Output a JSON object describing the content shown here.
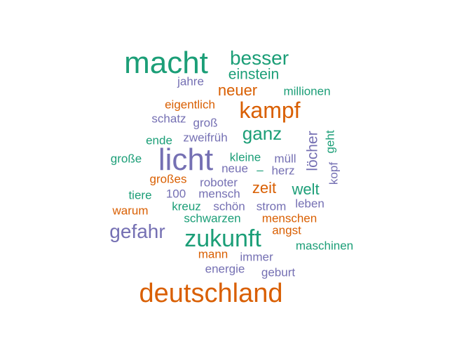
{
  "palette": {
    "green": "#1b9e77",
    "orange": "#d95f02",
    "purple": "#7570b3"
  },
  "words": [
    {
      "text": "deutschland",
      "weight": 10,
      "color": "orange"
    },
    {
      "text": "macht",
      "weight": 9,
      "color": "green"
    },
    {
      "text": "licht",
      "weight": 9,
      "color": "purple"
    },
    {
      "text": "zukunft",
      "weight": 8,
      "color": "green"
    },
    {
      "text": "kampf",
      "weight": 7,
      "color": "orange"
    },
    {
      "text": "gefahr",
      "weight": 6,
      "color": "purple"
    },
    {
      "text": "besser",
      "weight": 6,
      "color": "green"
    },
    {
      "text": "ganz",
      "weight": 6,
      "color": "green"
    },
    {
      "text": "löcher",
      "weight": 5,
      "color": "purple",
      "vertical": true
    },
    {
      "text": "einstein",
      "weight": 5,
      "color": "green"
    },
    {
      "text": "neuer",
      "weight": 5,
      "color": "orange"
    },
    {
      "text": "welt",
      "weight": 5,
      "color": "green"
    },
    {
      "text": "zeit",
      "weight": 5,
      "color": "orange"
    },
    {
      "text": "jahre",
      "weight": 3,
      "color": "purple"
    },
    {
      "text": "millionen",
      "weight": 3,
      "color": "green"
    },
    {
      "text": "eigentlich",
      "weight": 3,
      "color": "orange"
    },
    {
      "text": "schatz",
      "weight": 3,
      "color": "purple"
    },
    {
      "text": "groß",
      "weight": 3,
      "color": "purple"
    },
    {
      "text": "ende",
      "weight": 3,
      "color": "green"
    },
    {
      "text": "zweifrüh",
      "weight": 3,
      "color": "purple"
    },
    {
      "text": "geht",
      "weight": 3,
      "color": "green",
      "vertical": true
    },
    {
      "text": "kopf",
      "weight": 3,
      "color": "purple",
      "vertical": true
    },
    {
      "text": "große",
      "weight": 3,
      "color": "green"
    },
    {
      "text": "kleine",
      "weight": 3,
      "color": "green"
    },
    {
      "text": "müll",
      "weight": 3,
      "color": "purple"
    },
    {
      "text": "neue",
      "weight": 3,
      "color": "purple"
    },
    {
      "text": "–",
      "weight": 3,
      "color": "green"
    },
    {
      "text": "herz",
      "weight": 3,
      "color": "purple"
    },
    {
      "text": "großes",
      "weight": 3,
      "color": "orange"
    },
    {
      "text": "roboter",
      "weight": 3,
      "color": "purple"
    },
    {
      "text": "tiere",
      "weight": 3,
      "color": "green"
    },
    {
      "text": "100",
      "weight": 3,
      "color": "purple"
    },
    {
      "text": "mensch",
      "weight": 3,
      "color": "purple"
    },
    {
      "text": "leben",
      "weight": 3,
      "color": "purple"
    },
    {
      "text": "warum",
      "weight": 3,
      "color": "orange"
    },
    {
      "text": "kreuz",
      "weight": 3,
      "color": "green"
    },
    {
      "text": "schön",
      "weight": 3,
      "color": "purple"
    },
    {
      "text": "strom",
      "weight": 3,
      "color": "purple"
    },
    {
      "text": "schwarzen",
      "weight": 3,
      "color": "green"
    },
    {
      "text": "menschen",
      "weight": 3,
      "color": "orange"
    },
    {
      "text": "angst",
      "weight": 3,
      "color": "orange"
    },
    {
      "text": "maschinen",
      "weight": 3,
      "color": "green"
    },
    {
      "text": "mann",
      "weight": 3,
      "color": "orange"
    },
    {
      "text": "immer",
      "weight": 3,
      "color": "purple"
    },
    {
      "text": "energie",
      "weight": 3,
      "color": "purple"
    },
    {
      "text": "geburt",
      "weight": 3,
      "color": "purple"
    }
  ]
}
